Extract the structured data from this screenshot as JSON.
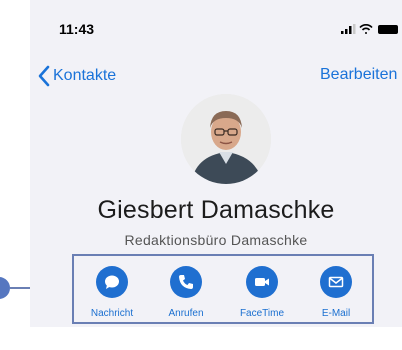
{
  "status_bar": {
    "time": "11:43",
    "icons": [
      "signal-icon",
      "wifi-icon",
      "battery-icon"
    ]
  },
  "nav": {
    "back_label": "Kontakte",
    "edit_label": "Bearbeiten"
  },
  "contact": {
    "name": "Giesbert Damaschke",
    "company": "Redaktionsbüro Damaschke"
  },
  "actions": [
    {
      "label": "Nachricht",
      "icon": "message-icon"
    },
    {
      "label": "Anrufen",
      "icon": "phone-icon"
    },
    {
      "label": "FaceTime",
      "icon": "video-icon"
    },
    {
      "label": "E-Mail",
      "icon": "mail-icon"
    }
  ],
  "colors": {
    "accent": "#1f6fd0",
    "highlight": "#6a7fb4",
    "background": "#f2f2f7"
  }
}
